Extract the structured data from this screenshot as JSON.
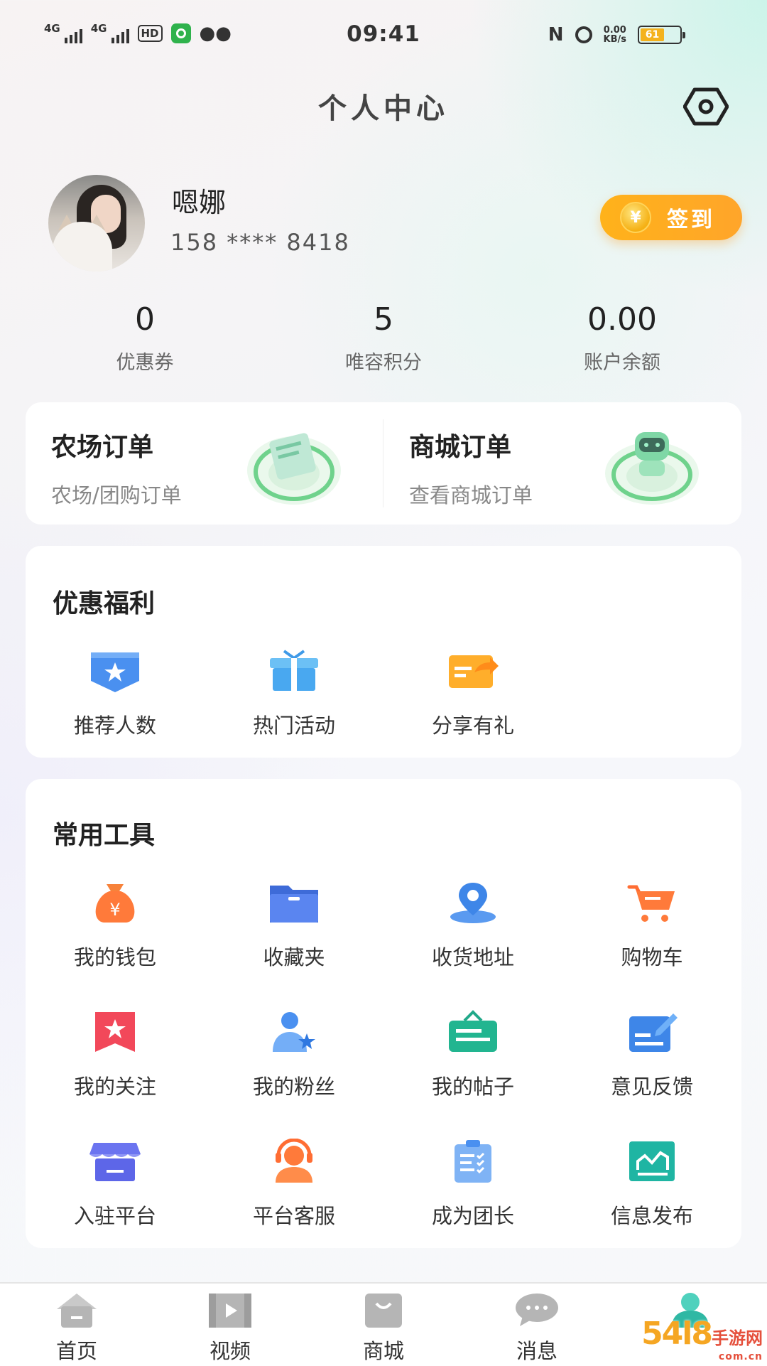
{
  "status_bar": {
    "network1": "4G",
    "network2": "4G",
    "hd_label": "HD",
    "time": "09:41",
    "nfc_label": "N",
    "speed_value": "0.00",
    "speed_unit": "KB/s",
    "battery_level": "61"
  },
  "header": {
    "title": "个人中心",
    "settings_icon": "settings-icon"
  },
  "profile": {
    "name": "嗯娜",
    "phone": "158 **** 8418",
    "signin_label": "签到",
    "coin_symbol": "¥"
  },
  "stats": [
    {
      "value": "0",
      "label": "优惠券"
    },
    {
      "value": "5",
      "label": "唯容积分"
    },
    {
      "value": "0.00",
      "label": "账户余额"
    }
  ],
  "orders": [
    {
      "title": "农场订单",
      "subtitle": "农场/团购订单"
    },
    {
      "title": "商城订单",
      "subtitle": "查看商城订单"
    }
  ],
  "benefits": {
    "title": "优惠福利",
    "items": [
      {
        "label": "推荐人数",
        "icon": "badge-star-icon"
      },
      {
        "label": "热门活动",
        "icon": "gift-icon"
      },
      {
        "label": "分享有礼",
        "icon": "share-card-icon"
      }
    ]
  },
  "tools": {
    "title": "常用工具",
    "items": [
      {
        "label": "我的钱包",
        "icon": "money-bag-icon"
      },
      {
        "label": "收藏夹",
        "icon": "folder-icon"
      },
      {
        "label": "收货地址",
        "icon": "location-pin-icon"
      },
      {
        "label": "购物车",
        "icon": "shopping-cart-icon"
      },
      {
        "label": "我的关注",
        "icon": "bookmark-star-icon"
      },
      {
        "label": "我的粉丝",
        "icon": "user-star-icon"
      },
      {
        "label": "我的帖子",
        "icon": "post-board-icon"
      },
      {
        "label": "意见反馈",
        "icon": "feedback-edit-icon"
      },
      {
        "label": "入驻平台",
        "icon": "storefront-icon"
      },
      {
        "label": "平台客服",
        "icon": "customer-service-icon"
      },
      {
        "label": "成为团长",
        "icon": "clipboard-list-icon"
      },
      {
        "label": "信息发布",
        "icon": "chart-board-icon"
      }
    ]
  },
  "tab_bar": {
    "items": [
      {
        "label": "首页",
        "icon": "home-icon"
      },
      {
        "label": "视频",
        "icon": "video-icon"
      },
      {
        "label": "商城",
        "icon": "shopping-bag-icon"
      },
      {
        "label": "消息",
        "icon": "message-icon"
      },
      {
        "label": "",
        "icon": "profile-icon",
        "active": true
      }
    ]
  },
  "watermark": {
    "text": "54l8",
    "cn": "手游网",
    "domain": "com.cn"
  },
  "colors": {
    "accent_orange": "#ffa52a",
    "active_tab": "#43c9b4"
  }
}
